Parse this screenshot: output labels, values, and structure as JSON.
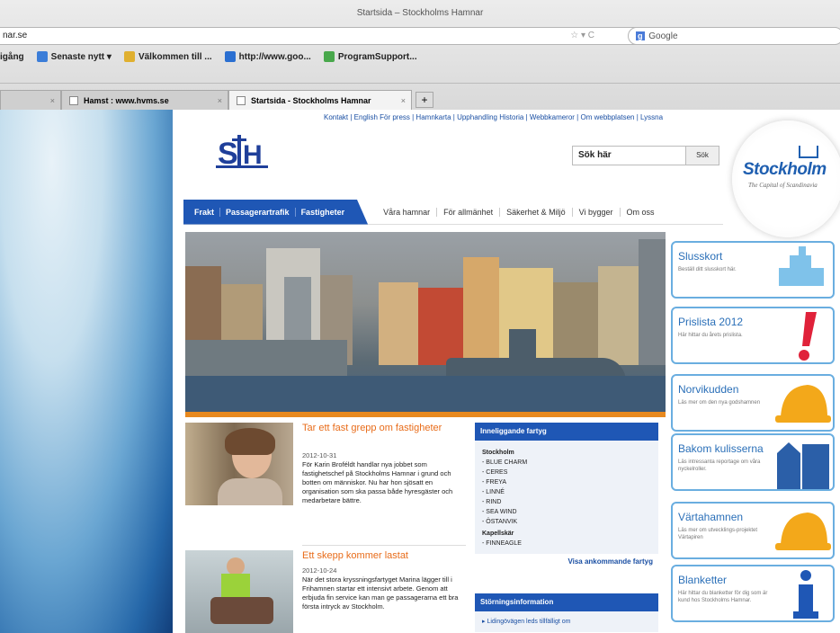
{
  "browser": {
    "window_title": "Startsida – Stockholms Hamnar",
    "url": "nar.se",
    "search_engine": "Google",
    "bookmarks": [
      {
        "label": "igång",
        "color": "#7ab0e0"
      },
      {
        "label": "Senaste nytt ▾",
        "color": "#3b7dd8"
      },
      {
        "label": "Välkommen till ...",
        "color": "#e0b030"
      },
      {
        "label": "http://www.goo...",
        "color": "#2a6fd1"
      },
      {
        "label": "ProgramSupport...",
        "color": "#49a84c"
      }
    ],
    "tabs": [
      {
        "label": "",
        "active": false
      },
      {
        "label": "Hamst : www.hvms.se",
        "active": false
      },
      {
        "label": "Startsida - Stockholms Hamnar",
        "active": true
      }
    ]
  },
  "site": {
    "top_links": "Kontakt | English   För press | Hamnkarta | Upphandling   Historia | Webbkameror | Om webbplatsen | Lyssna",
    "search_placeholder": "Sök här",
    "search_button": "Sök",
    "stockholm_brand": "Stockholm",
    "stockholm_caption": "The Capital of Scandinavia",
    "nav_blue": [
      "Frakt",
      "Passagerartrafik",
      "Fastigheter"
    ],
    "nav_gray": [
      "Våra hamnar",
      "För allmänhet",
      "Säkerhet & Miljö",
      "Vi bygger",
      "Om oss"
    ]
  },
  "articles": [
    {
      "title": "Tar ett fast grepp om fastigheter",
      "date": "2012-10-31",
      "body": "För Karin Broféldt handlar nya jobbet som fastighetschef på Stockholms Hamnar i grund och botten om människor. Nu har hon sjösatt en organisation som ska passa både hyresgäster och medarbetare bättre."
    },
    {
      "title": "Ett skepp kommer lastat",
      "date": "2012-10-24",
      "body": "När det stora kryssningsfartyget Marina lägger till i Frihamnen startar ett intensivt arbete. Genom att erbjuda fin service kan man ge passagerarna ett bra första intryck av Stockholm."
    }
  ],
  "ships_box": {
    "title": "Inneliggande fartyg",
    "groups": [
      {
        "name": "Stockholm",
        "ships": [
          "- BLUE CHARM",
          "- CERES",
          "- FREYA",
          "- LINNÉ",
          "- RIND",
          "- SEA WIND",
          "- ÖSTANVIK"
        ]
      },
      {
        "name": "Kapellskär",
        "ships": [
          "- FINNEAGLE"
        ]
      }
    ],
    "link": "Visa ankommande fartyg"
  },
  "disturbance_box": {
    "title": "Störningsinformation",
    "item": "▸ Lidingövägen leds tillfälligt om"
  },
  "side_cards": [
    {
      "title": "Slusskort",
      "subtitle": "Beställ ditt slusskort här.",
      "icon": "ship-icon",
      "color": "#7fc2ea"
    },
    {
      "title": "Prislista 2012",
      "subtitle": "Här hittar du årets prislista.",
      "icon": "exclamation-icon",
      "color": "#e0223a"
    },
    {
      "title": "Norvikudden",
      "subtitle": "Läs mer om den nya godshamnen",
      "icon": "hardhat-icon",
      "color": "#f3a81a"
    },
    {
      "title": "Bakom kulisserna",
      "subtitle": "Läs intressanta reportage om våra nyckelroller.",
      "icon": "buildings-icon",
      "color": "#2b5fa8"
    },
    {
      "title": "Värtahamnen",
      "subtitle": "Läs mer om utvecklings-projektet Värtapiren",
      "icon": "hardhat-icon",
      "color": "#f3a81a"
    },
    {
      "title": "Blanketter",
      "subtitle": "Här hittar du blanketter för dig som är kund hos Stockholms Hamnar.",
      "icon": "info-icon",
      "color": "#1f57b5"
    }
  ]
}
